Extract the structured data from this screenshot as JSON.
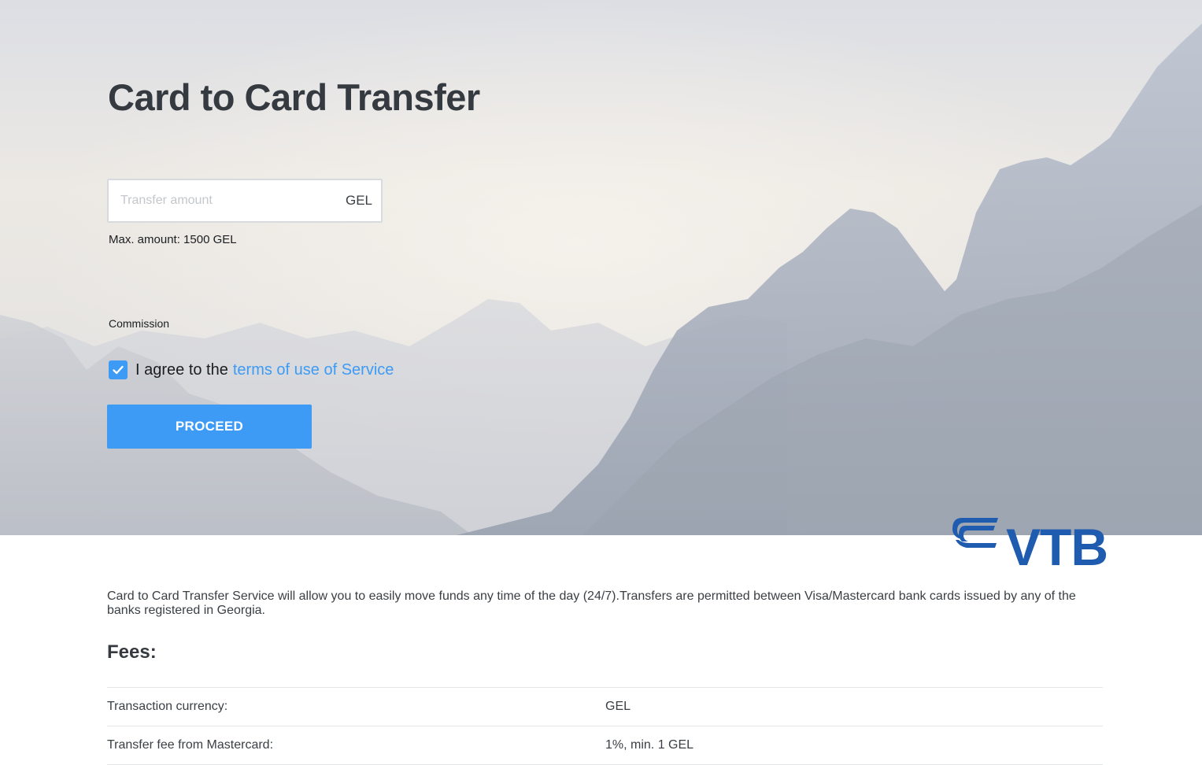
{
  "hero": {
    "title": "Card to Card Transfer",
    "amount_placeholder": "Transfer amount",
    "amount_value": "",
    "currency": "GEL",
    "max_amount": "Max. amount: 1500 GEL",
    "commission_label": "Commission",
    "agree_checked": true,
    "agree_text": "I agree to the",
    "terms_link": "terms of use of Service",
    "proceed_label": "PROCEED"
  },
  "logo": {
    "text": "VTB"
  },
  "content": {
    "description": "Card to Card Transfer Service will allow you to easily move funds any time of the day (24/7).Transfers are permitted between Visa/Mastercard bank cards issued by any of the banks registered in Georgia.",
    "fees_title": "Fees:",
    "fees": [
      {
        "label": "Transaction currency:",
        "value": "GEL"
      },
      {
        "label": "Transfer fee from Mastercard:",
        "value": "1%, min. 1 GEL"
      }
    ]
  },
  "colors": {
    "accent": "#3d9bf5",
    "brand": "#1f5bae",
    "title": "#343a40"
  },
  "icons": {
    "checkbox": "checkmark-icon",
    "logo": "vtb-logo-icon"
  }
}
